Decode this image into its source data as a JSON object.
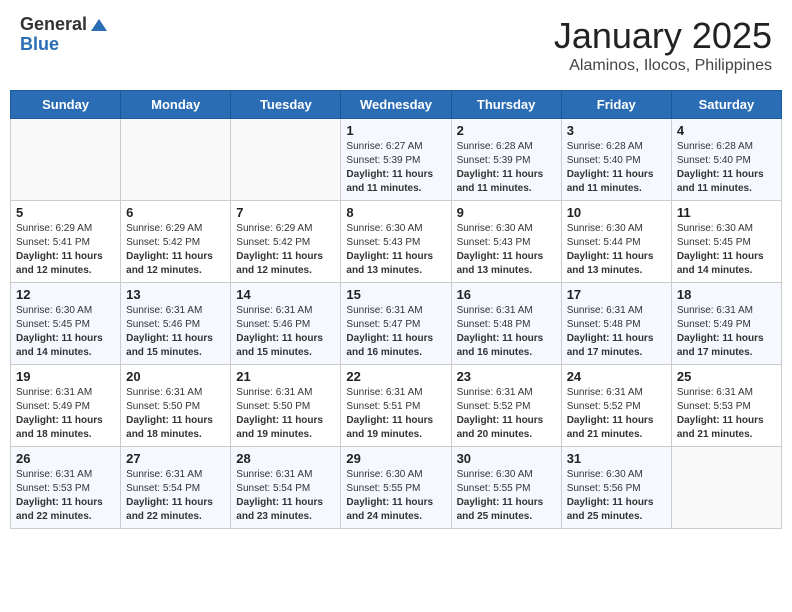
{
  "header": {
    "logo": {
      "general": "General",
      "blue": "Blue"
    },
    "title": "January 2025",
    "location": "Alaminos, Ilocos, Philippines"
  },
  "weekdays": [
    "Sunday",
    "Monday",
    "Tuesday",
    "Wednesday",
    "Thursday",
    "Friday",
    "Saturday"
  ],
  "weeks": [
    [
      {
        "day": "",
        "info": ""
      },
      {
        "day": "",
        "info": ""
      },
      {
        "day": "",
        "info": ""
      },
      {
        "day": "1",
        "info": "Sunrise: 6:27 AM\nSunset: 5:39 PM\nDaylight: 11 hours and 11 minutes."
      },
      {
        "day": "2",
        "info": "Sunrise: 6:28 AM\nSunset: 5:39 PM\nDaylight: 11 hours and 11 minutes."
      },
      {
        "day": "3",
        "info": "Sunrise: 6:28 AM\nSunset: 5:40 PM\nDaylight: 11 hours and 11 minutes."
      },
      {
        "day": "4",
        "info": "Sunrise: 6:28 AM\nSunset: 5:40 PM\nDaylight: 11 hours and 11 minutes."
      }
    ],
    [
      {
        "day": "5",
        "info": "Sunrise: 6:29 AM\nSunset: 5:41 PM\nDaylight: 11 hours and 12 minutes."
      },
      {
        "day": "6",
        "info": "Sunrise: 6:29 AM\nSunset: 5:42 PM\nDaylight: 11 hours and 12 minutes."
      },
      {
        "day": "7",
        "info": "Sunrise: 6:29 AM\nSunset: 5:42 PM\nDaylight: 11 hours and 12 minutes."
      },
      {
        "day": "8",
        "info": "Sunrise: 6:30 AM\nSunset: 5:43 PM\nDaylight: 11 hours and 13 minutes."
      },
      {
        "day": "9",
        "info": "Sunrise: 6:30 AM\nSunset: 5:43 PM\nDaylight: 11 hours and 13 minutes."
      },
      {
        "day": "10",
        "info": "Sunrise: 6:30 AM\nSunset: 5:44 PM\nDaylight: 11 hours and 13 minutes."
      },
      {
        "day": "11",
        "info": "Sunrise: 6:30 AM\nSunset: 5:45 PM\nDaylight: 11 hours and 14 minutes."
      }
    ],
    [
      {
        "day": "12",
        "info": "Sunrise: 6:30 AM\nSunset: 5:45 PM\nDaylight: 11 hours and 14 minutes."
      },
      {
        "day": "13",
        "info": "Sunrise: 6:31 AM\nSunset: 5:46 PM\nDaylight: 11 hours and 15 minutes."
      },
      {
        "day": "14",
        "info": "Sunrise: 6:31 AM\nSunset: 5:46 PM\nDaylight: 11 hours and 15 minutes."
      },
      {
        "day": "15",
        "info": "Sunrise: 6:31 AM\nSunset: 5:47 PM\nDaylight: 11 hours and 16 minutes."
      },
      {
        "day": "16",
        "info": "Sunrise: 6:31 AM\nSunset: 5:48 PM\nDaylight: 11 hours and 16 minutes."
      },
      {
        "day": "17",
        "info": "Sunrise: 6:31 AM\nSunset: 5:48 PM\nDaylight: 11 hours and 17 minutes."
      },
      {
        "day": "18",
        "info": "Sunrise: 6:31 AM\nSunset: 5:49 PM\nDaylight: 11 hours and 17 minutes."
      }
    ],
    [
      {
        "day": "19",
        "info": "Sunrise: 6:31 AM\nSunset: 5:49 PM\nDaylight: 11 hours and 18 minutes."
      },
      {
        "day": "20",
        "info": "Sunrise: 6:31 AM\nSunset: 5:50 PM\nDaylight: 11 hours and 18 minutes."
      },
      {
        "day": "21",
        "info": "Sunrise: 6:31 AM\nSunset: 5:50 PM\nDaylight: 11 hours and 19 minutes."
      },
      {
        "day": "22",
        "info": "Sunrise: 6:31 AM\nSunset: 5:51 PM\nDaylight: 11 hours and 19 minutes."
      },
      {
        "day": "23",
        "info": "Sunrise: 6:31 AM\nSunset: 5:52 PM\nDaylight: 11 hours and 20 minutes."
      },
      {
        "day": "24",
        "info": "Sunrise: 6:31 AM\nSunset: 5:52 PM\nDaylight: 11 hours and 21 minutes."
      },
      {
        "day": "25",
        "info": "Sunrise: 6:31 AM\nSunset: 5:53 PM\nDaylight: 11 hours and 21 minutes."
      }
    ],
    [
      {
        "day": "26",
        "info": "Sunrise: 6:31 AM\nSunset: 5:53 PM\nDaylight: 11 hours and 22 minutes."
      },
      {
        "day": "27",
        "info": "Sunrise: 6:31 AM\nSunset: 5:54 PM\nDaylight: 11 hours and 22 minutes."
      },
      {
        "day": "28",
        "info": "Sunrise: 6:31 AM\nSunset: 5:54 PM\nDaylight: 11 hours and 23 minutes."
      },
      {
        "day": "29",
        "info": "Sunrise: 6:30 AM\nSunset: 5:55 PM\nDaylight: 11 hours and 24 minutes."
      },
      {
        "day": "30",
        "info": "Sunrise: 6:30 AM\nSunset: 5:55 PM\nDaylight: 11 hours and 25 minutes."
      },
      {
        "day": "31",
        "info": "Sunrise: 6:30 AM\nSunset: 5:56 PM\nDaylight: 11 hours and 25 minutes."
      },
      {
        "day": "",
        "info": ""
      }
    ]
  ]
}
